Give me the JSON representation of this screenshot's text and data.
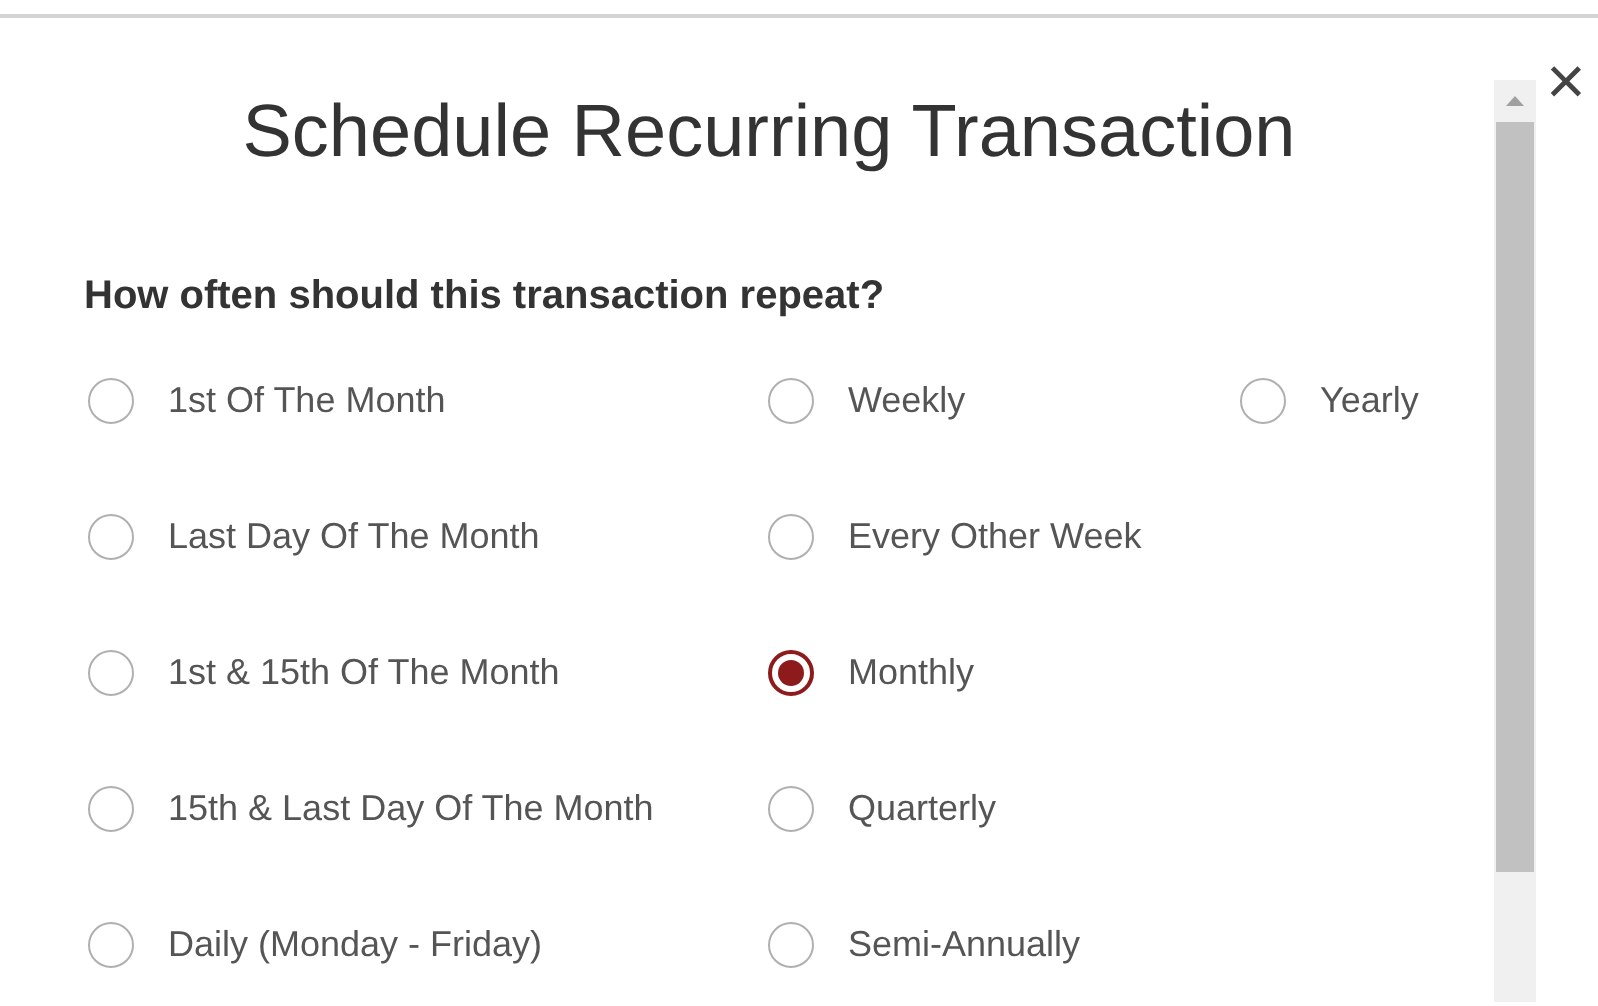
{
  "dialog": {
    "title": "Schedule Recurring Transaction",
    "close_label": "×"
  },
  "question": "How often should this transaction repeat?",
  "option_columns": [
    [
      {
        "label": "1st Of The Month",
        "selected": false
      },
      {
        "label": "Last Day Of The Month",
        "selected": false
      },
      {
        "label": "1st & 15th Of The Month",
        "selected": false
      },
      {
        "label": "15th & Last Day Of The Month",
        "selected": false
      },
      {
        "label": "Daily (Monday - Friday)",
        "selected": false
      }
    ],
    [
      {
        "label": "Weekly",
        "selected": false
      },
      {
        "label": "Every Other Week",
        "selected": false
      },
      {
        "label": "Monthly",
        "selected": true
      },
      {
        "label": "Quarterly",
        "selected": false
      },
      {
        "label": "Semi-Annually",
        "selected": false
      }
    ],
    [
      {
        "label": "Yearly",
        "selected": false
      }
    ]
  ]
}
